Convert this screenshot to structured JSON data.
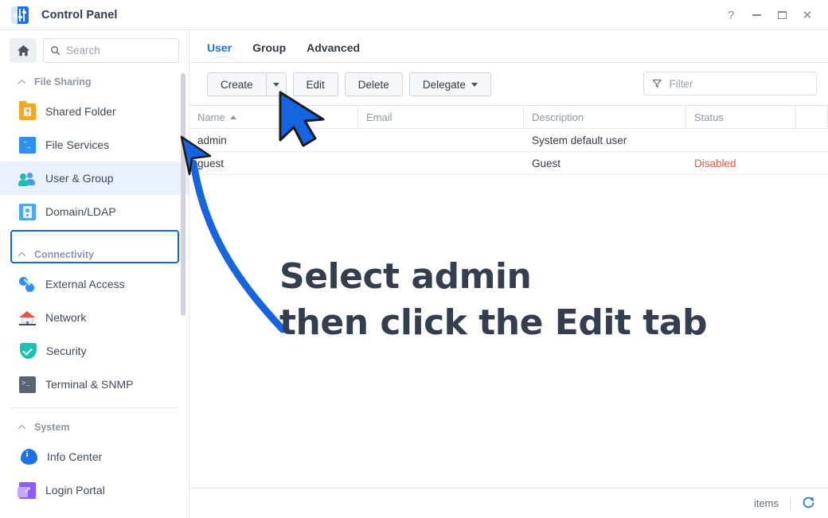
{
  "window": {
    "title": "Control Panel",
    "app_icon": "sliders-icon",
    "controls": [
      {
        "name": "help-button",
        "glyph": "?"
      },
      {
        "name": "minimize-button",
        "glyph": "—"
      },
      {
        "name": "maximize-button",
        "glyph": "□"
      },
      {
        "name": "close-button",
        "glyph": "✕"
      }
    ]
  },
  "sidebar": {
    "home_icon": "home-icon",
    "search": {
      "placeholder": "Search",
      "value": "",
      "icon": "search-icon"
    },
    "groups": [
      {
        "label": "File Sharing",
        "items": [
          {
            "label": "Shared Folder",
            "icon": "shared-folder-icon",
            "selected": false
          },
          {
            "label": "File Services",
            "icon": "file-services-icon",
            "selected": false
          },
          {
            "label": "User & Group",
            "icon": "user-group-icon",
            "selected": true
          },
          {
            "label": "Domain/LDAP",
            "icon": "domain-ldap-icon",
            "selected": false
          }
        ]
      },
      {
        "label": "Connectivity",
        "items": [
          {
            "label": "External Access",
            "icon": "external-access-icon",
            "selected": false
          },
          {
            "label": "Network",
            "icon": "network-icon",
            "selected": false
          },
          {
            "label": "Security",
            "icon": "security-icon",
            "selected": false
          },
          {
            "label": "Terminal & SNMP",
            "icon": "terminal-snmp-icon",
            "selected": false
          }
        ]
      },
      {
        "label": "System",
        "items": [
          {
            "label": "Info Center",
            "icon": "info-center-icon",
            "selected": false
          },
          {
            "label": "Login Portal",
            "icon": "login-portal-icon",
            "selected": false
          }
        ]
      }
    ]
  },
  "main": {
    "tabs": [
      {
        "label": "User",
        "active": true
      },
      {
        "label": "Group",
        "active": false
      },
      {
        "label": "Advanced",
        "active": false
      }
    ],
    "toolbar": {
      "create_label": "Create",
      "create_dropdown_icon": "chevron-down-icon",
      "edit_label": "Edit",
      "delete_label": "Delete",
      "delegate_label": "Delegate",
      "delegate_dropdown_icon": "chevron-down-icon"
    },
    "filter": {
      "placeholder": "Filter",
      "value": "",
      "icon": "funnel-icon"
    },
    "table": {
      "columns": [
        "Name",
        "Email",
        "Description",
        "Status"
      ],
      "sort_column": "Name",
      "sort_direction": "ascending",
      "rows": [
        {
          "name": "admin",
          "email": "",
          "description": "System default user",
          "status": ""
        },
        {
          "name": "guest",
          "email": "",
          "description": "Guest",
          "status": "Disabled"
        }
      ]
    },
    "statusbar": {
      "items_label": "items",
      "refresh_icon": "refresh-icon"
    }
  },
  "annotations": {
    "line1": "Select admin",
    "line2": "then click the Edit tab",
    "arrow_to_admin": "curved-arrow",
    "cursor_on_edit": "cursor-arrow",
    "accent_color": "#1565e0",
    "text_color": "#343e4e"
  },
  "colors": {
    "accent": "#1a73e8",
    "selection": "#e8f1fd",
    "status_disabled": "#e8574a",
    "border": "#dfe3e8"
  }
}
